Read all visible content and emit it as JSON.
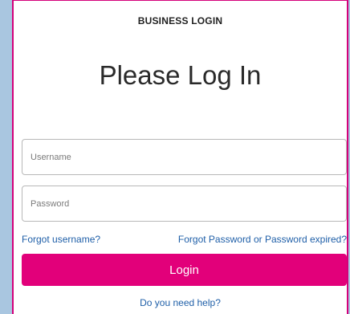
{
  "header": {
    "title": "BUSINESS LOGIN"
  },
  "main": {
    "heading": "Please Log In"
  },
  "form": {
    "username_placeholder": "Username",
    "password_placeholder": "Password",
    "forgot_username": "Forgot username?",
    "forgot_password": "Forgot Password or Password expired?",
    "login_label": "Login",
    "help_text": "Do you need help?"
  },
  "colors": {
    "accent": "#e2007a",
    "link": "#1f5fa8"
  }
}
